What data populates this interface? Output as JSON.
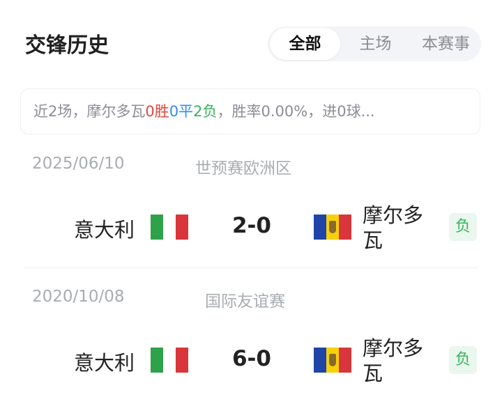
{
  "header": {
    "title": "交锋历史"
  },
  "tabs": [
    {
      "label": "全部",
      "active": true
    },
    {
      "label": "主场",
      "active": false
    },
    {
      "label": "本赛事",
      "active": false
    }
  ],
  "summary": {
    "prefix": "近2场，摩尔多瓦",
    "wins": "0胜",
    "draws": "0平",
    "losses": "2负",
    "suffix": "，胜率0.00%，进0球..."
  },
  "colors": {
    "win": "#e0463c",
    "draw": "#2f8ef0",
    "loss": "#36b35a"
  },
  "matches": [
    {
      "date": "2025/06/10",
      "competition": "世预赛欧洲区",
      "home_team": "意大利",
      "home_flag": "italy-flag",
      "score": "2-0",
      "away_flag": "moldova-flag",
      "away_team": "摩尔多瓦",
      "result": "负"
    },
    {
      "date": "2020/10/08",
      "competition": "国际友谊赛",
      "home_team": "意大利",
      "home_flag": "italy-flag",
      "score": "6-0",
      "away_flag": "moldova-flag",
      "away_team": "摩尔多瓦",
      "result": "负"
    }
  ]
}
